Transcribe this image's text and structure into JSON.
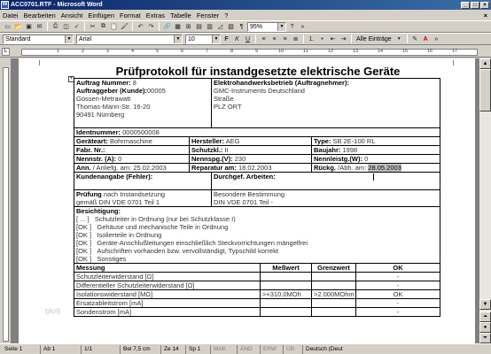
{
  "window": {
    "title": "ACC0701.RTF - Microsoft Word",
    "minimize": "_",
    "maximize": "□",
    "close": "×"
  },
  "menu": [
    "Datei",
    "Bearbeiten",
    "Ansicht",
    "Einfügen",
    "Format",
    "Extras",
    "Tabelle",
    "Fenster",
    "?"
  ],
  "menu_close": "×",
  "formatting": {
    "style": "Standard",
    "font": "Arial",
    "size": "10",
    "zoom": "95%",
    "all_entries": "Alle Einträge"
  },
  "ruler_ticks": [
    "1",
    "2",
    "3",
    "4",
    "5",
    "6",
    "7",
    "8",
    "9",
    "10",
    "11",
    "12",
    "13",
    "14",
    "15",
    "16",
    "17"
  ],
  "document": {
    "title": "Prüfprotokoll für instandgesetzte elektrische Geräte",
    "auftrag_nummer_label": "Auftrag Nummer:",
    "auftrag_nummer_value": "8",
    "ebetrieb_label": "Elektrohandwerksbetrieb (Auftragnehmer):",
    "auftraggeber_label": "Auftraggeber (Kunde):",
    "auftraggeber_value": "00005",
    "customer_name": "Gossen-Metrawatt",
    "customer_street": "Thomas-Mann-Str. 16-20",
    "customer_city": "90491  Nürnberg",
    "contractor_name": "GMC-Instruments Deutschland",
    "contractor_street": "Straße",
    "contractor_city": "PLZ ORT",
    "ident_label": "Identnummer:",
    "ident_value": "0000500008",
    "geraeteart_label": "Geräteart:",
    "geraeteart_value": "Bohrmaschine",
    "hersteller_label": "Hersteller:",
    "hersteller_value": "AEG",
    "typ_label": "Type:",
    "typ_value": "SB 2E-100 RL",
    "fabr_label": "Fabr. Nr.:",
    "schutzkl_label": "Schutzkl.:",
    "schutzkl_value": "II",
    "baujahr_label": "Baujahr:",
    "baujahr_value": "1998",
    "nennstr_label": "Nennstr. (A):",
    "nennstr_value": "0",
    "nennspg_label": "Nennspg.(V):",
    "nennspg_value": "230",
    "nennleistg_label": "Nennleistg.(W):",
    "nennleistg_value": "0",
    "ann_label": "Ann.",
    "ann_rest": "/ Anliefg. am: 25.02.2003",
    "reparatur_label": "Reparatur am:",
    "reparatur_value": "18.02.2003",
    "rueckg_label": "Rückg.",
    "rueckg_rest": "/Abh. am:",
    "rueckg_value": "28.05.2003",
    "kundenangabe_label": "Kundenangabe (Fehler):",
    "arbeiten_label": "Durchgef. Arbeiten:",
    "pruefung_label": "Prüfung",
    "pruefung_rest": "nach Instandsetzung",
    "pruefung_norm": "gemäß DIN VDE 0701 Teil 1",
    "besondere_label": "Besondere Bestimmung",
    "besondere_norm": "DIN VDE 0701 Teil -",
    "besichtigung_label": "Besichtigung:",
    "checks": [
      {
        "mark": "[ ... ]",
        "text": "Schutzleiter in Ordnung (nur bei Schutzklasse I)"
      },
      {
        "mark": "[OK ]",
        "text": "Gehäuse und mechanische Teile in Ordnung"
      },
      {
        "mark": "[OK ]",
        "text": "Isolierteile in Ordnung"
      },
      {
        "mark": "[OK ]",
        "text": "Geräte-Anschlußleitungen einschließlich Steckvorrichtungen mängelfrei"
      },
      {
        "mark": "[OK ]",
        "text": "Aufschriften vorhanden bzw. vervollständigt, Typschild korrekt"
      },
      {
        "mark": "[OK ]",
        "text": "Sonstiges"
      }
    ],
    "measure_headers": [
      "Messung",
      "Meßwert",
      "Grenzwert",
      "OK"
    ],
    "measurements": [
      {
        "name": "Schutzleiterwiderstand [Ω]",
        "value": "",
        "limit": "",
        "ok": "-"
      },
      {
        "name": "Differentieller Schutzleiterwiderstand [Ω]",
        "value": "",
        "limit": "",
        "ok": "-"
      },
      {
        "name": "Isolationswiderstand [MΩ]",
        "value": ">+310.0MOh",
        "limit": ">2.000MOhm",
        "ok": "OK"
      },
      {
        "name": "Ersatzableitstrom [mA]",
        "value": "",
        "limit": "",
        "ok": "-"
      },
      {
        "name": "Sondenstrom [mA]",
        "value": "",
        "limit": "",
        "ok": "-"
      }
    ],
    "watermark": "blog"
  },
  "status": {
    "page": "Seite 1",
    "section": "Ab 1",
    "pages": "1/1",
    "position": "Bei 7,5 cm",
    "line": "Ze 14",
    "column": "Sp 1",
    "mak": "MAK",
    "aend": "ÄND",
    "erw": "ERW",
    "ub": "ÜB",
    "language": "Deutsch (Deut"
  },
  "colors": {
    "titlebar_start": "#0a246a",
    "titlebar_end": "#3a6ea5",
    "chrome": "#d4d0c8",
    "workspace": "#808080"
  }
}
